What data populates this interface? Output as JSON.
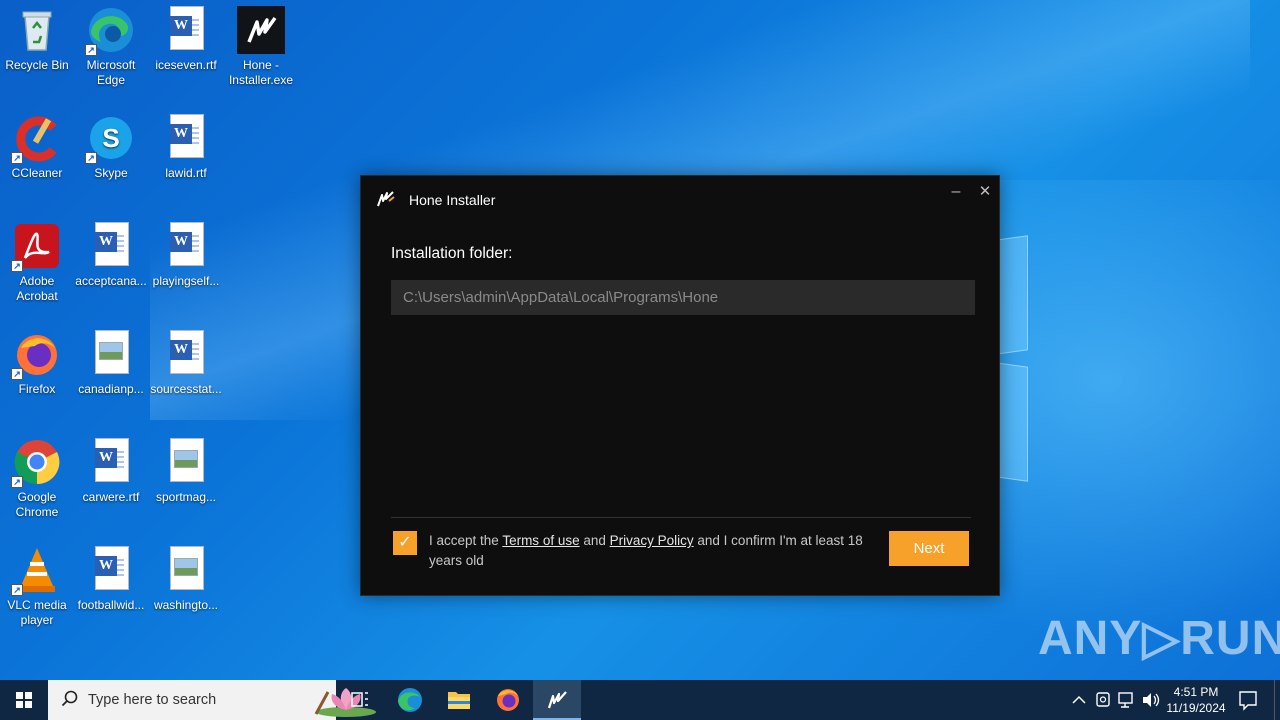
{
  "desktop": {
    "icons": [
      {
        "label": "Recycle Bin"
      },
      {
        "label": "Microsoft Edge"
      },
      {
        "label": "iceseven.rtf"
      },
      {
        "label": "Hone - Installer.exe"
      },
      {
        "label": "CCleaner"
      },
      {
        "label": "Skype"
      },
      {
        "label": "lawid.rtf"
      },
      {
        "label": "Adobe Acrobat"
      },
      {
        "label": "acceptcana..."
      },
      {
        "label": "playingself..."
      },
      {
        "label": "Firefox"
      },
      {
        "label": "canadianp..."
      },
      {
        "label": "sourcesstat..."
      },
      {
        "label": "Google Chrome"
      },
      {
        "label": "carwere.rtf"
      },
      {
        "label": "sportmag..."
      },
      {
        "label": "VLC media player"
      },
      {
        "label": "footballwid..."
      },
      {
        "label": "washingto..."
      }
    ]
  },
  "installer": {
    "title": "Hone Installer",
    "minimize": "–",
    "close": "✕",
    "folder_label": "Installation folder:",
    "folder_value": "C:\\Users\\admin\\AppData\\Local\\Programs\\Hone",
    "checkbox_mark": "✓",
    "accept_prefix": "I accept the ",
    "terms_link": "Terms of use",
    "accept_and": " and ",
    "privacy_link": "Privacy Policy",
    "accept_suffix": " and I confirm I'm at least 18 years old",
    "next_label": "Next",
    "accent": "#f7a12a"
  },
  "watermark": "ANY▷RUN",
  "taskbar": {
    "search_placeholder": "Type here to search",
    "time": "4:51 PM",
    "date": "11/19/2024"
  }
}
